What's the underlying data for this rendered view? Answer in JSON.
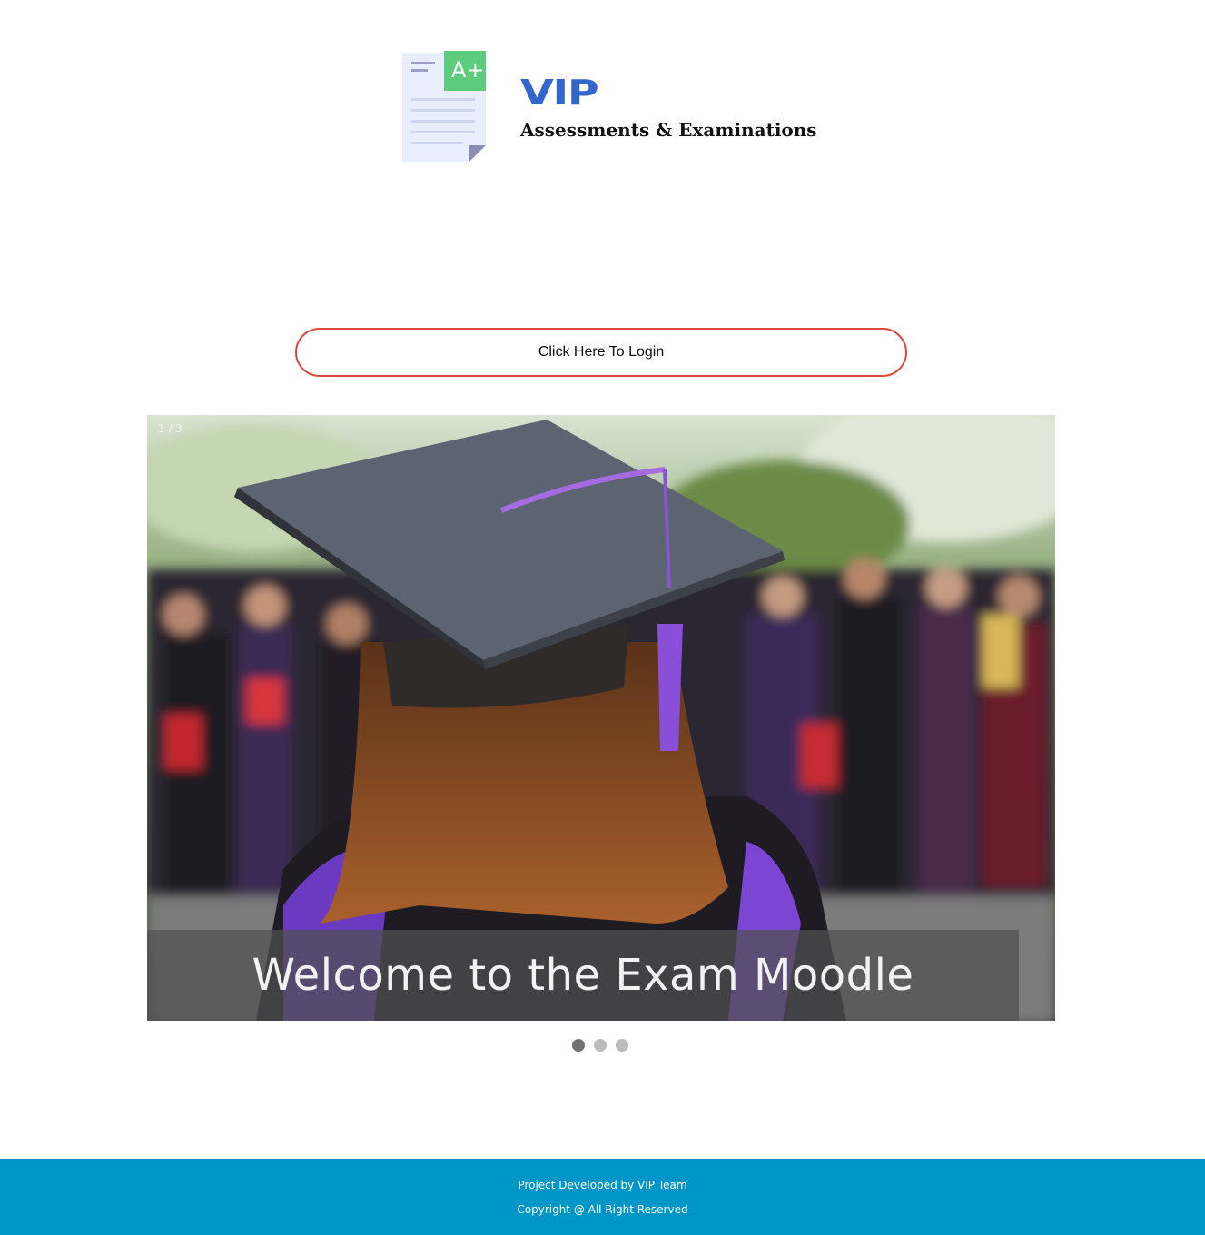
{
  "logo": {
    "icon": "document-grade-a-plus-icon",
    "badge_text": "A+",
    "brand_name": "VIP",
    "brand_tagline": "Assessments & Examinations"
  },
  "login": {
    "label": "Click Here To Login"
  },
  "slideshow": {
    "counter": "1 / 3",
    "caption": "Welcome to the Exam Moodle",
    "image": "graduation-cap-student-photo",
    "total_slides": 3,
    "active_slide": 1
  },
  "footer": {
    "line1": "Project Developed by VIP Team",
    "line2": "Copyright @ All Right Reserved"
  },
  "colors": {
    "brand_blue": "#3366cc",
    "login_border": "#e0463a",
    "footer_bg": "#0096c8",
    "badge_green": "#5ccb7c"
  }
}
